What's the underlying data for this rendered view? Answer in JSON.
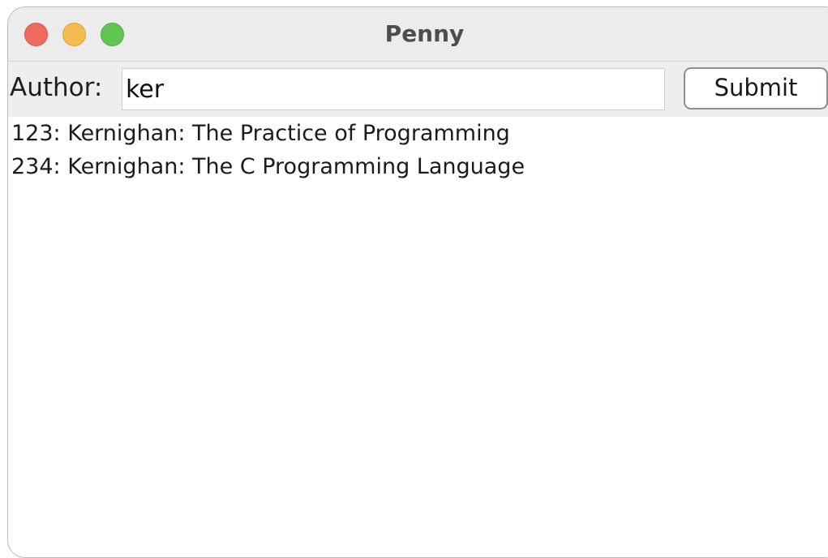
{
  "window": {
    "title": "Penny"
  },
  "form": {
    "author_label": "Author:",
    "author_value": "ker",
    "submit_label": "Submit"
  },
  "results": [
    "123: Kernighan: The Practice of Programming",
    "234: Kernighan: The C Programming Language"
  ],
  "colors": {
    "close": "#ee6a5f",
    "minimize": "#f5bd4f",
    "zoom": "#61c554",
    "button_border": "#8a8f96"
  },
  "icons": [
    "close-icon",
    "minimize-icon",
    "zoom-icon"
  ]
}
